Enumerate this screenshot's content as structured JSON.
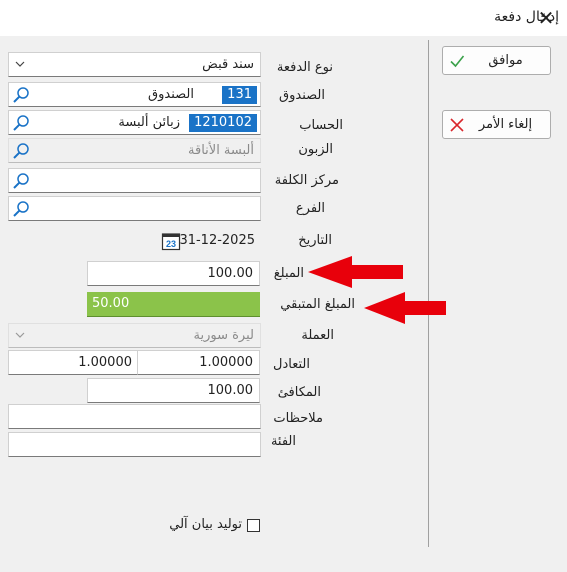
{
  "window": {
    "title": "إدخال دفعة"
  },
  "buttons": {
    "ok": "موافق",
    "cancel": "إلغاء الأمر"
  },
  "form": {
    "payment_type": {
      "label": "نوع الدفعة",
      "value": "سند قبض"
    },
    "cashbox": {
      "label": "الصندوق",
      "code": "131",
      "name": "الصندوق"
    },
    "account": {
      "label": "الحساب",
      "code": "1210102",
      "name": "زبائن ألبسة"
    },
    "customer": {
      "label": "الزبون",
      "value": "ألبسة الأناقة"
    },
    "cost_center": {
      "label": "مركز الكلفة",
      "value": ""
    },
    "branch": {
      "label": "الفرع",
      "value": ""
    },
    "date": {
      "label": "التاريخ",
      "value": "31-12-2025",
      "calendar_day": "23"
    },
    "amount": {
      "label": "المبلغ",
      "value": "100.00"
    },
    "remaining": {
      "label": "المبلغ المتبقي",
      "value": "50.00"
    },
    "currency": {
      "label": "العملة",
      "value": "ليرة سورية"
    },
    "exchange": {
      "label": "التعادل",
      "value1": "1.00000",
      "value2": "1.00000"
    },
    "equivalent": {
      "label": "المكافئ",
      "value": "100.00"
    },
    "notes": {
      "label": "ملاحظات",
      "value": ""
    },
    "category": {
      "label": "الفئة",
      "value": ""
    },
    "auto_statement": {
      "label": "توليد بيان آلي",
      "checked": false
    }
  },
  "colors": {
    "code_badge": "#1a73c7",
    "remaining_bg": "#8bc34a",
    "arrow": "#e8000b"
  }
}
